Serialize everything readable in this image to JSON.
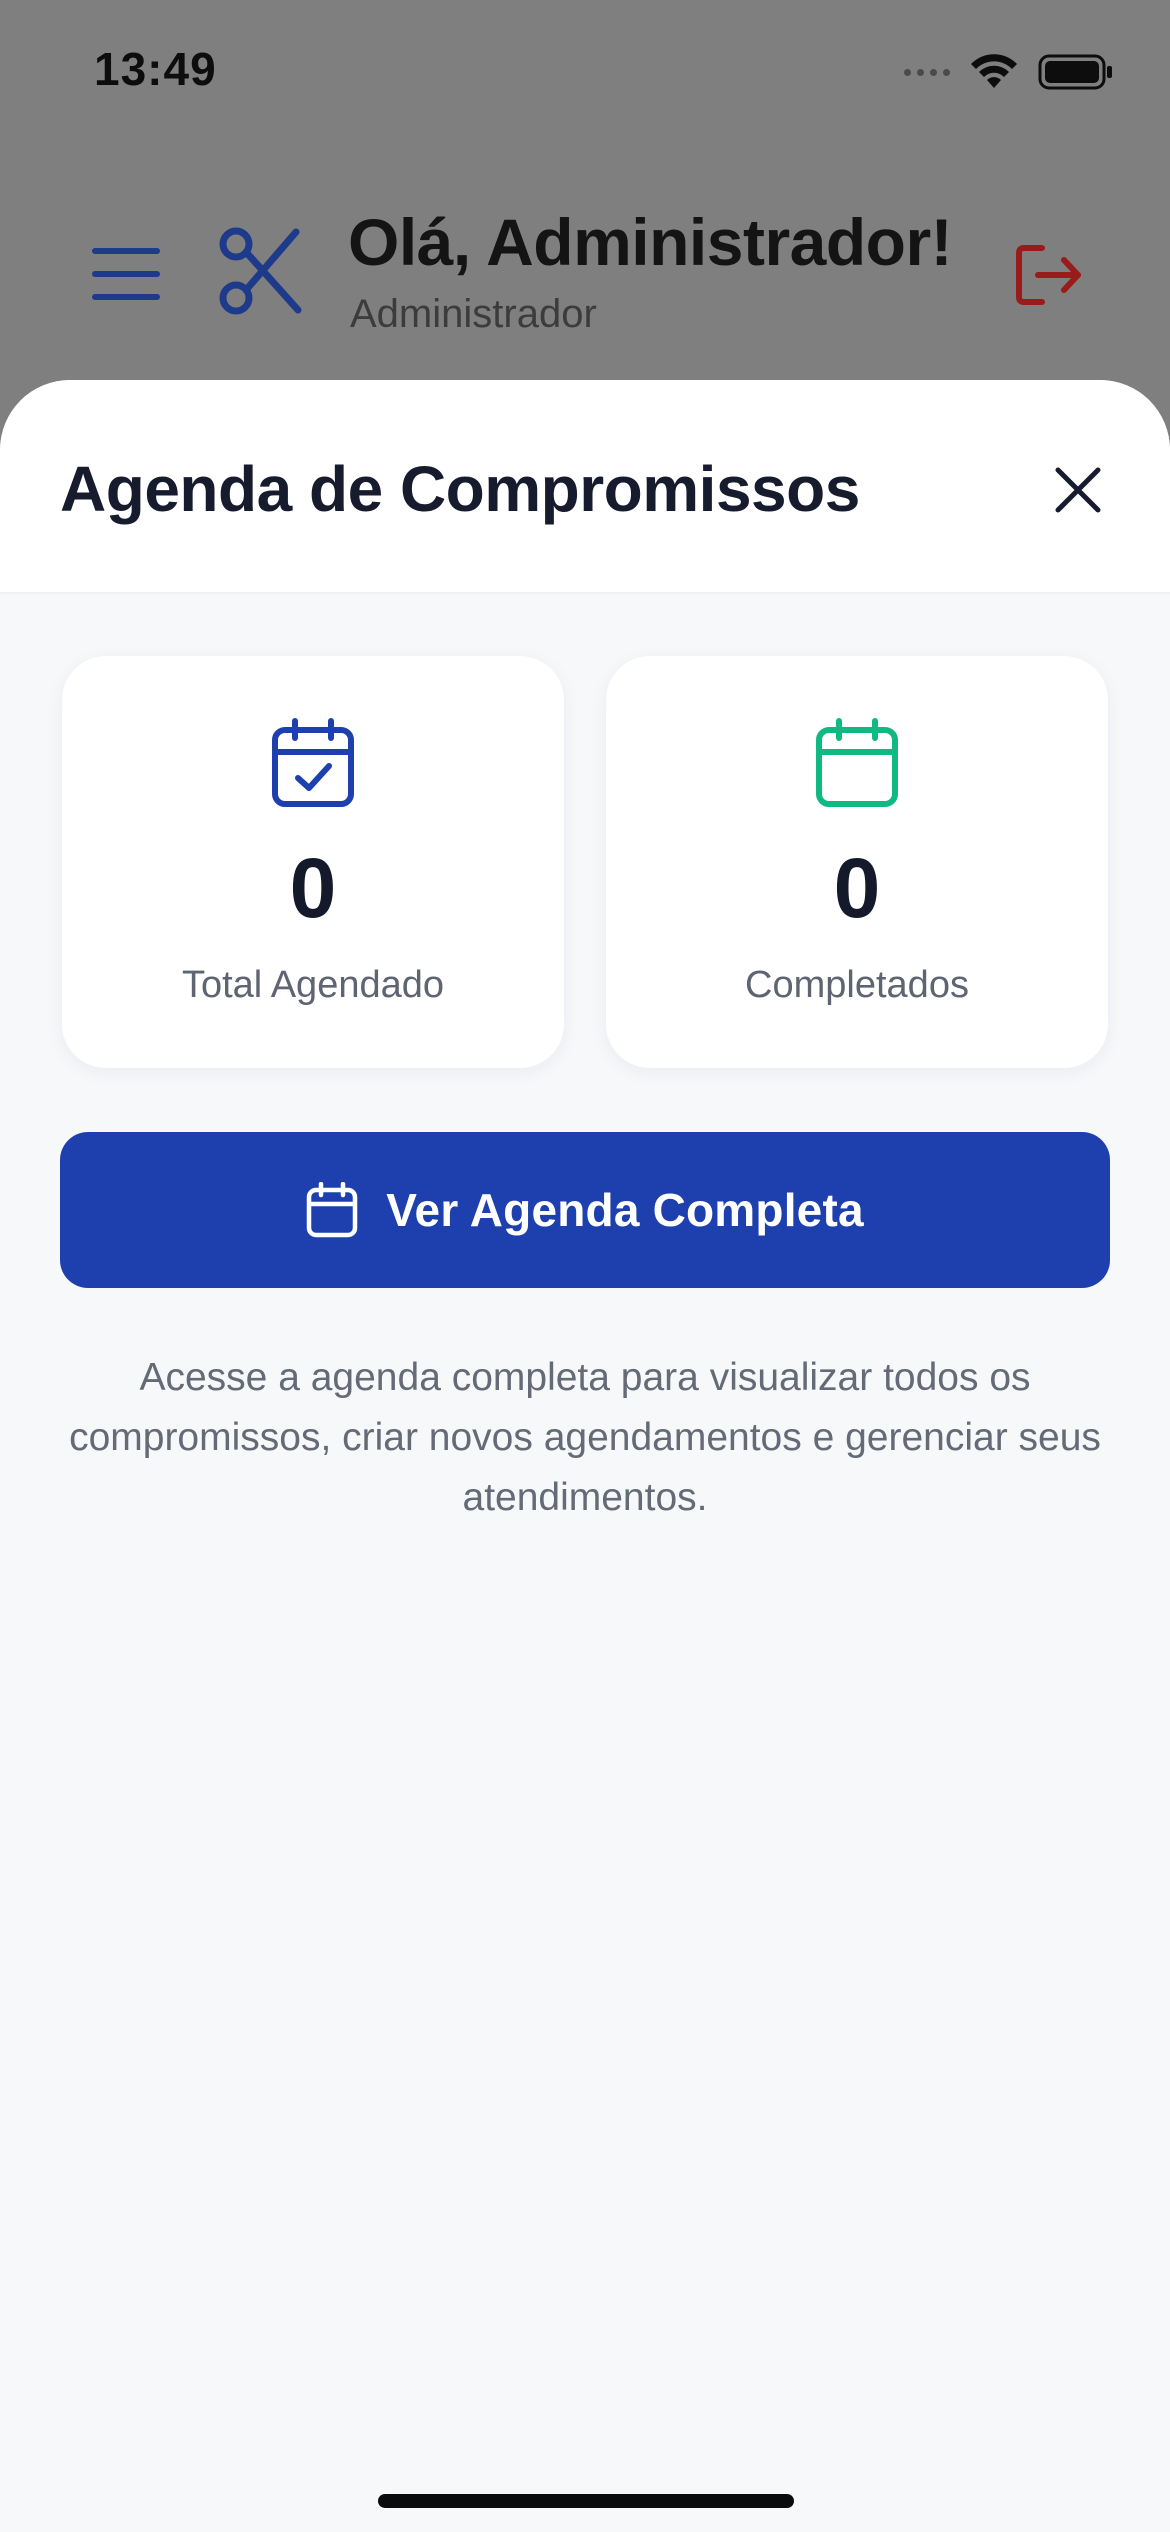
{
  "status_bar": {
    "time": "13:49",
    "icons": [
      "cellular-signal-icon",
      "wifi-icon",
      "battery-icon"
    ]
  },
  "header": {
    "greeting": "Olá, Administrador!",
    "role": "Administrador",
    "icons": {
      "menu": "menu-icon",
      "logo": "scissors-icon",
      "logout": "logout-icon"
    },
    "colors": {
      "brand": "#1e3a8a",
      "logout": "#991b1b"
    }
  },
  "sheet": {
    "title": "Agenda de Compromissos",
    "close_icon": "close-icon",
    "stats": [
      {
        "value": "0",
        "label": "Total Agendado",
        "icon": "calendar-check-icon",
        "color": "#1e40af"
      },
      {
        "value": "0",
        "label": "Completados",
        "icon": "calendar-icon",
        "color": "#10b981"
      }
    ],
    "primary_button": {
      "label": "Ver Agenda Completa",
      "icon": "calendar-icon",
      "color": "#1e40af"
    },
    "description": "Acesse a agenda completa para visualizar todos os compromissos, criar novos agendamentos e gerenciar seus atendimentos."
  }
}
